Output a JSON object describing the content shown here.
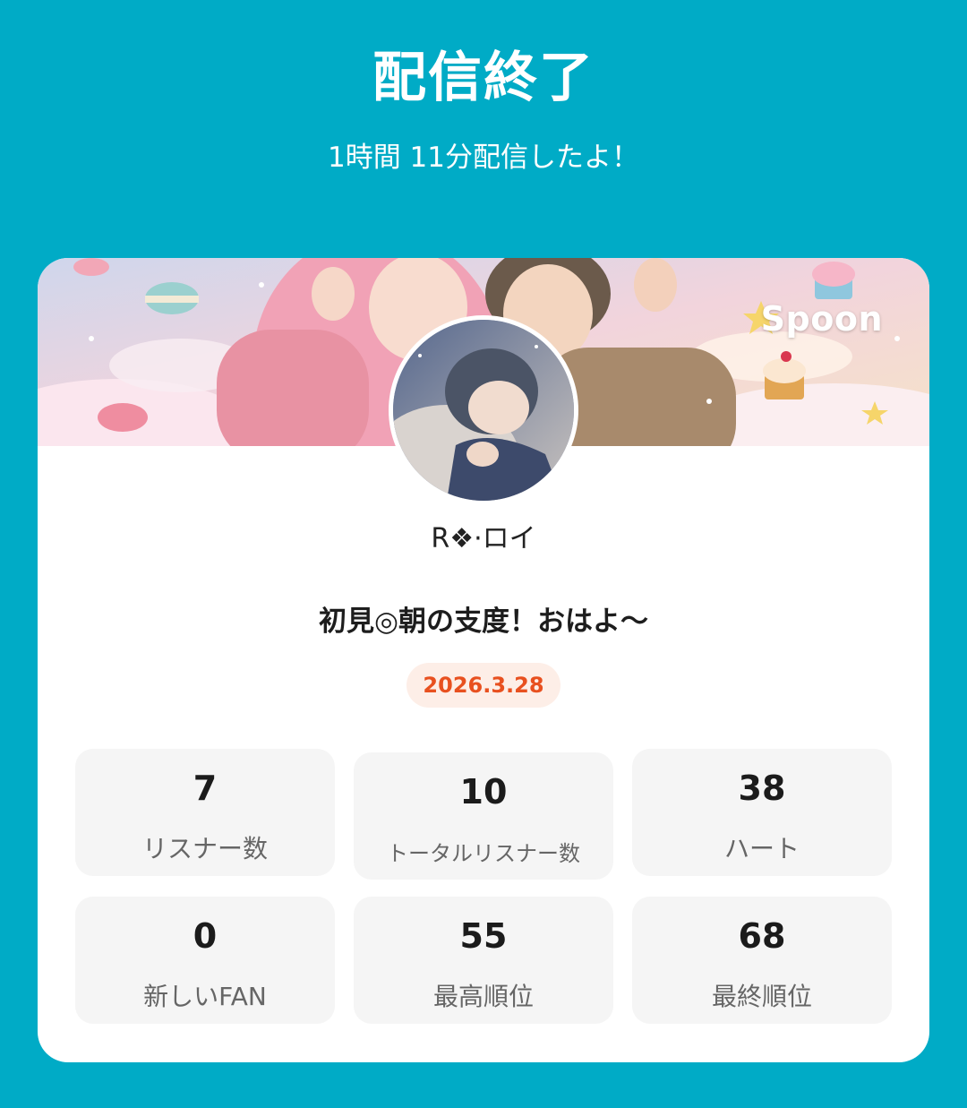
{
  "header": {
    "title": "配信終了",
    "subtitle": "1時間 11分配信したよ！"
  },
  "card": {
    "brand": "Spoon",
    "username": "R❖·ロイ",
    "stream_title": "初見◎朝の支度！おはよ〜",
    "date": "2026.3.28"
  },
  "stats": [
    {
      "value": "7",
      "label": "リスナー数"
    },
    {
      "value": "10",
      "label": "トータルリスナー数"
    },
    {
      "value": "38",
      "label": "ハート"
    },
    {
      "value": "0",
      "label": "新しいFAN"
    },
    {
      "value": "55",
      "label": "最高順位"
    },
    {
      "value": "68",
      "label": "最終順位"
    }
  ],
  "colors": {
    "background": "#00abc6",
    "card": "#ffffff",
    "date_text": "#e8501f",
    "date_badge": "#fdeee7",
    "stat_tile": "#f5f5f5"
  }
}
